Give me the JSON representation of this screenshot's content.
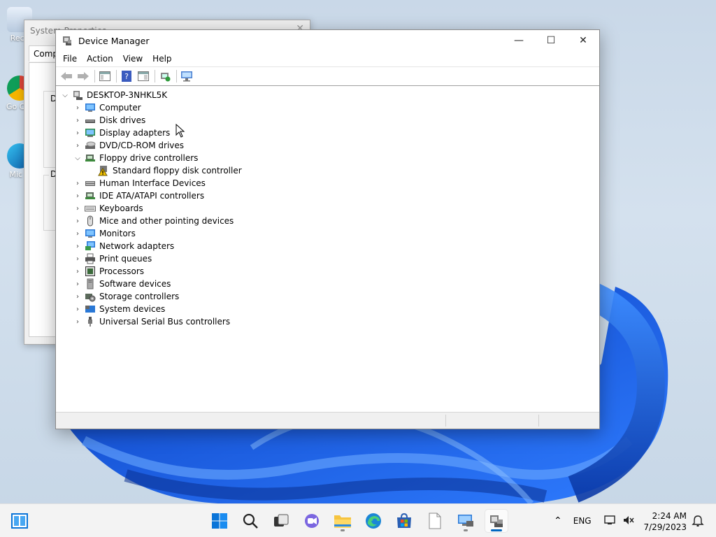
{
  "desktop": {
    "icons": [
      {
        "label": "Recy"
      },
      {
        "label": "Go Chr"
      },
      {
        "label": "Mic E"
      }
    ]
  },
  "background_window": {
    "title": "System Properties",
    "tab": "Compu",
    "group1": "De",
    "group2": "De"
  },
  "window": {
    "title": "Device Manager",
    "minimize": "—",
    "maximize": "☐",
    "close": "✕"
  },
  "menu": [
    "File",
    "Action",
    "View",
    "Help"
  ],
  "toolbar": [
    {
      "icon": "back-arrow-icon"
    },
    {
      "icon": "forward-arrow-icon"
    },
    {
      "icon": "show-hide-console-tree-icon"
    },
    {
      "icon": "help-icon"
    },
    {
      "icon": "action-pane-icon"
    },
    {
      "icon": "update-driver-icon"
    },
    {
      "icon": "scan-hardware-icon"
    }
  ],
  "tree": {
    "root": "DESKTOP-3NHKL5K",
    "categories": [
      {
        "label": "Computer",
        "icon": "computer-icon"
      },
      {
        "label": "Disk drives",
        "icon": "disk-drive-icon"
      },
      {
        "label": "Display adapters",
        "icon": "display-adapter-icon"
      },
      {
        "label": "DVD/CD-ROM drives",
        "icon": "dvd-drive-icon"
      },
      {
        "label": "Floppy drive controllers",
        "icon": "floppy-controller-icon",
        "expanded": true,
        "children": [
          {
            "label": "Standard floppy disk controller",
            "icon": "warning-device-icon"
          }
        ]
      },
      {
        "label": "Human Interface Devices",
        "icon": "hid-icon"
      },
      {
        "label": "IDE ATA/ATAPI controllers",
        "icon": "ide-controller-icon"
      },
      {
        "label": "Keyboards",
        "icon": "keyboard-icon"
      },
      {
        "label": "Mice and other pointing devices",
        "icon": "mouse-icon"
      },
      {
        "label": "Monitors",
        "icon": "monitor-icon"
      },
      {
        "label": "Network adapters",
        "icon": "network-adapter-icon"
      },
      {
        "label": "Print queues",
        "icon": "printer-icon"
      },
      {
        "label": "Processors",
        "icon": "processor-icon"
      },
      {
        "label": "Software devices",
        "icon": "software-device-icon"
      },
      {
        "label": "Storage controllers",
        "icon": "storage-controller-icon"
      },
      {
        "label": "System devices",
        "icon": "system-device-icon"
      },
      {
        "label": "Universal Serial Bus controllers",
        "icon": "usb-icon"
      }
    ]
  },
  "taskbar": {
    "apps": [
      "start",
      "search",
      "task-view",
      "chat",
      "file-explorer",
      "edge",
      "store",
      "notepad",
      "remote-desktop",
      "device-manager"
    ],
    "language": "ENG",
    "time": "2:24 AM",
    "date": "7/29/2023"
  },
  "colors": {
    "accent": "#0067c0",
    "wallpaper_blue": "#1a5fe0",
    "warning": "#f5c400"
  }
}
